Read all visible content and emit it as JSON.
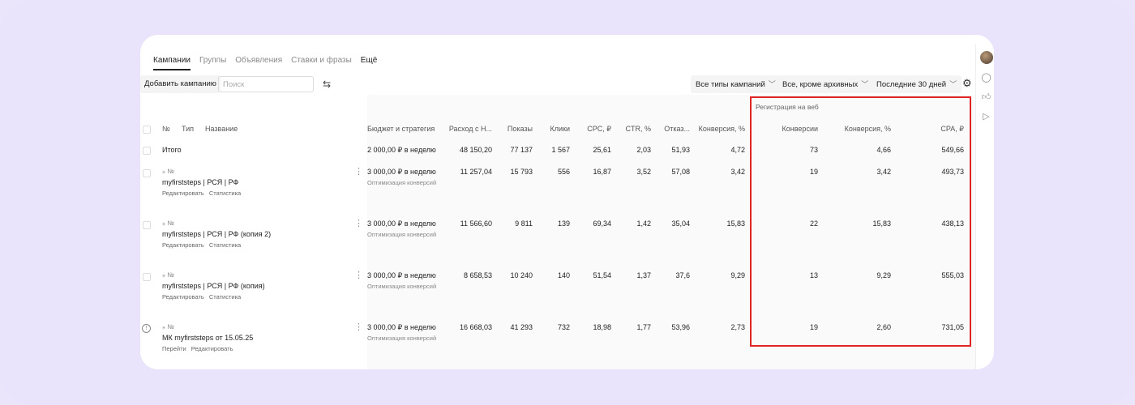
{
  "tabs": [
    {
      "label": "Кампании",
      "active": true
    },
    {
      "label": "Группы",
      "active": false
    },
    {
      "label": "Объявления",
      "active": false
    },
    {
      "label": "Ставки и фразы",
      "active": false
    },
    {
      "label": "Ещё",
      "active": false
    }
  ],
  "toolbar": {
    "add_campaign": "Добавить кампанию",
    "search_placeholder": "Поиск",
    "campaign_type": "Все типы кампаний",
    "status_filter": "Все, кроме архивных",
    "period": "Последние 30 дней"
  },
  "table": {
    "headers": {
      "num": "№",
      "type": "Тип",
      "name": "Название",
      "budget": "Бюджет и стратегия",
      "spend": "Расход с Н...",
      "impressions": "Показы",
      "clicks": "Клики",
      "cpc": "CPC, ₽",
      "ctr": "CTR, %",
      "bounce": "Отказ...",
      "conv_rate": "Конверсия, %"
    },
    "goal_group": {
      "title": "Регистрация на веб",
      "conversions": "Конверсии",
      "conv_rate": "Конверсия, %",
      "cpa": "CPA, ₽"
    },
    "total": {
      "label": "Итого",
      "budget": "2 000,00 ₽ в неделю",
      "spend": "48 150,20",
      "impressions": "77 137",
      "clicks": "1 567",
      "cpc": "25,61",
      "ctr": "2,03",
      "bounce": "51,93",
      "conv_rate": "4,72",
      "g_conversions": "73",
      "g_conv_rate": "4,66",
      "g_cpa": "549,66"
    },
    "rows": [
      {
        "num_label": "№",
        "name": "myfirststeps | РСЯ | РФ",
        "links": [
          "Редактировать",
          "Статистика"
        ],
        "budget": "3 000,00 ₽ в неделю",
        "strategy": "Оптимизация конверсий",
        "spend": "11 257,04",
        "impressions": "15 793",
        "clicks": "556",
        "cpc": "16,87",
        "ctr": "3,52",
        "bounce": "57,08",
        "conv_rate": "3,42",
        "g_conversions": "19",
        "g_conv_rate": "3,42",
        "g_cpa": "493,73"
      },
      {
        "num_label": "№",
        "name": "myfirststeps | РСЯ | РФ (копия 2)",
        "links": [
          "Редактировать",
          "Статистика"
        ],
        "budget": "3 000,00 ₽ в неделю",
        "strategy": "Оптимизация конверсий",
        "spend": "11 566,60",
        "impressions": "9 811",
        "clicks": "139",
        "cpc": "69,34",
        "ctr": "1,42",
        "bounce": "35,04",
        "conv_rate": "15,83",
        "g_conversions": "22",
        "g_conv_rate": "15,83",
        "g_cpa": "438,13"
      },
      {
        "num_label": "№",
        "name": "myfirststeps | РСЯ | РФ (копия)",
        "links": [
          "Редактировать",
          "Статистика"
        ],
        "budget": "3 000,00 ₽ в неделю",
        "strategy": "Оптимизация конверсий",
        "spend": "8 658,53",
        "impressions": "10 240",
        "clicks": "140",
        "cpc": "51,54",
        "ctr": "1,37",
        "bounce": "37,6",
        "conv_rate": "9,29",
        "g_conversions": "13",
        "g_conv_rate": "9,29",
        "g_cpa": "555,03"
      },
      {
        "num_label": "№",
        "name": "МК myfirststeps от 15.05.25",
        "links": [
          "Перейти",
          "Редактировать"
        ],
        "budget": "3 000,00 ₽ в неделю",
        "strategy": "Оптимизация конверсий",
        "spend": "16 668,03",
        "impressions": "41 293",
        "clicks": "732",
        "cpc": "18,98",
        "ctr": "1,77",
        "bounce": "53,96",
        "conv_rate": "2,73",
        "g_conversions": "19",
        "g_conv_rate": "2,60",
        "g_cpa": "731,05"
      }
    ]
  },
  "colors": {
    "background": "#e9e3fb",
    "highlight": "#e02424"
  }
}
